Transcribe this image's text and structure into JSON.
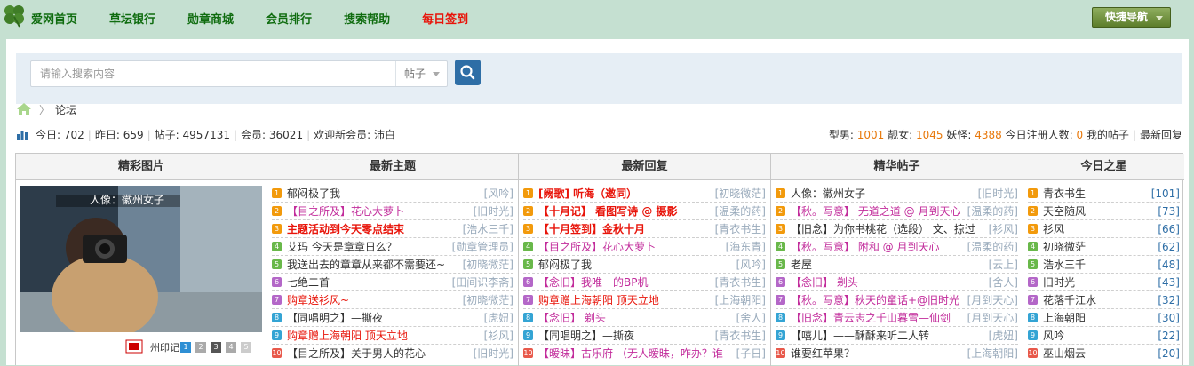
{
  "nav": {
    "items": [
      "爱网首页",
      "草坛银行",
      "勋章商城",
      "会员排行",
      "搜索帮助",
      "每日签到"
    ],
    "quick": "快捷导航"
  },
  "search": {
    "placeholder": "请输入搜索内容",
    "type": "帖子"
  },
  "breadcrumb": {
    "label": "论坛"
  },
  "stats": {
    "today_label": "今日:",
    "today": "702",
    "yesterday_label": "昨日:",
    "yesterday": "659",
    "posts_label": "帖子:",
    "posts": "4957131",
    "members_label": "会员:",
    "members": "36021",
    "welcome_label": "欢迎新会员:",
    "welcome": "沛白",
    "male_label": "型男:",
    "male": "1001",
    "female_label": "靓女:",
    "female": "1045",
    "yao_label": "妖怪:",
    "yao": "4388",
    "reg_label": "今日注册人数:",
    "reg": "0",
    "myposts": "我的帖子",
    "latest": "最新回复"
  },
  "columns": [
    "精彩图片",
    "最新主题",
    "最新回复",
    "精华帖子",
    "今日之星"
  ],
  "picture": {
    "caption": "人像：徽州女子",
    "pages": [
      "1",
      "2",
      "3",
      "4",
      "5"
    ],
    "logo": "州印记"
  },
  "badge_colors": [
    "#f29a0c",
    "#f29a0c",
    "#f29a0c",
    "#69b84a",
    "#69b84a",
    "#b467c8",
    "#b467c8",
    "#34a4d4",
    "#34a4d4",
    "#e8594b"
  ],
  "latest_topics": [
    {
      "n": "1",
      "title": "郁闷极了我",
      "user": "[风吟]",
      "color": "#333"
    },
    {
      "n": "2",
      "title": "【目之所及】花心大萝卜",
      "user": "[旧时光]",
      "color": "#c22c9b"
    },
    {
      "n": "3",
      "title": "主题活动到今天零点结束",
      "user": "[浩水三千]",
      "color": "#e8140a",
      "bold": true
    },
    {
      "n": "4",
      "title": "艾玛 今天是章章日么？",
      "user": "[勋章管理员]",
      "color": "#333"
    },
    {
      "n": "5",
      "title": "我送出去的章章从来都不需要还~",
      "user": "[初晓微茫]",
      "color": "#333"
    },
    {
      "n": "6",
      "title": "七绝二首",
      "user": "[田间识李斋]",
      "color": "#333"
    },
    {
      "n": "7",
      "title": "购章送衫风~",
      "user": "[初晓微茫]",
      "color": "#e8140a"
    },
    {
      "n": "8",
      "title": "【同唱明之】—撕夜",
      "user": "[虎妞]",
      "color": "#333"
    },
    {
      "n": "9",
      "title": "购章赠上海朝阳 顶天立地",
      "user": "[衫风]",
      "color": "#e8140a"
    },
    {
      "n": "10",
      "title": "【目之所及】关于男人的花心",
      "user": "[旧时光]",
      "color": "#333"
    }
  ],
  "latest_replies": [
    {
      "n": "1",
      "title": "[阙歌] 听海（邀同）",
      "user": "[初晓微茫]",
      "color": "#e8140a",
      "bold": true
    },
    {
      "n": "2",
      "title": "【十月记】 看图写诗 @ 摄影",
      "user": "[温柔的药]",
      "color": "#e8140a",
      "bold": true
    },
    {
      "n": "3",
      "title": "【十月签到】金秋十月",
      "user": "[青衣书生]",
      "color": "#e8140a",
      "bold": true
    },
    {
      "n": "4",
      "title": "【目之所及】花心大萝卜",
      "user": "[海东青]",
      "color": "#c22c9b"
    },
    {
      "n": "5",
      "title": "郁闷极了我",
      "user": "[风吟]",
      "color": "#333"
    },
    {
      "n": "6",
      "title": "【念旧】我唯一的BP机",
      "user": "[青衣书生]",
      "color": "#c22c9b"
    },
    {
      "n": "7",
      "title": "购章赠上海朝阳 顶天立地",
      "user": "[上海朝阳]",
      "color": "#e8140a"
    },
    {
      "n": "8",
      "title": "【念旧】 剃头",
      "user": "[舍人]",
      "color": "#c22c9b"
    },
    {
      "n": "9",
      "title": "【同唱明之】—撕夜",
      "user": "[青衣书生]",
      "color": "#333"
    },
    {
      "n": "10",
      "title": "【暧昧】古乐府 （无人暧昧，咋办？谁",
      "user": "[子日]",
      "color": "#c22c9b"
    }
  ],
  "featured": [
    {
      "n": "1",
      "title": "人像：徽州女子",
      "user": "[旧时光]",
      "color": "#333"
    },
    {
      "n": "2",
      "title": "【秋。写意】 无道之道 @ 月到天心",
      "user": "[温柔的药]",
      "color": "#c22c9b"
    },
    {
      "n": "3",
      "title": "【旧念】为你书桃花（选段） 文、掠过",
      "user": "[衫风]",
      "color": "#333"
    },
    {
      "n": "4",
      "title": "【秋。写意】 附和 @ 月到天心",
      "user": "[温柔的药]",
      "color": "#c22c9b"
    },
    {
      "n": "5",
      "title": "老屋",
      "user": "[云上]",
      "color": "#333"
    },
    {
      "n": "6",
      "title": "【念旧】 剃头",
      "user": "[舍人]",
      "color": "#c22c9b"
    },
    {
      "n": "7",
      "title": "【秋。写意】秋天的童话+@旧时光",
      "user": "[月到天心]",
      "color": "#c22c9b"
    },
    {
      "n": "8",
      "title": "【旧念】青云志之千山暮雪—仙剑",
      "user": "[月到天心]",
      "color": "#c22c9b"
    },
    {
      "n": "9",
      "title": "【嘻儿】——酥酥来听二人转",
      "user": "[虎妞]",
      "color": "#333"
    },
    {
      "n": "10",
      "title": "谁要红苹果？",
      "user": "[上海朝阳]",
      "color": "#333"
    }
  ],
  "stars": [
    {
      "n": "1",
      "name": "青衣书生",
      "score": "[101]"
    },
    {
      "n": "2",
      "name": "天空随风",
      "score": "[73]"
    },
    {
      "n": "3",
      "name": "衫风",
      "score": "[66]"
    },
    {
      "n": "4",
      "name": "初晓微茫",
      "score": "[62]"
    },
    {
      "n": "5",
      "name": "浩水三千",
      "score": "[48]"
    },
    {
      "n": "6",
      "name": "旧时光",
      "score": "[43]"
    },
    {
      "n": "7",
      "name": "花落千江水",
      "score": "[32]"
    },
    {
      "n": "8",
      "name": "上海朝阳",
      "score": "[30]"
    },
    {
      "n": "9",
      "name": "风吟",
      "score": "[22]"
    },
    {
      "n": "10",
      "name": "巫山烟云",
      "score": "[20]"
    }
  ]
}
